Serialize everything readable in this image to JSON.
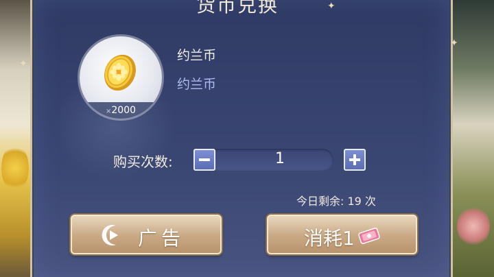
{
  "dialog": {
    "title": "货币兑换"
  },
  "item": {
    "name": "约兰币",
    "description": "约兰币",
    "quantity_prefix": "×",
    "quantity": "2000",
    "icon": "gold-coin-icon"
  },
  "purchase": {
    "count_label": "购买次数:",
    "count_value": "1",
    "remaining_text": "今日剩余: 19 次"
  },
  "buttons": {
    "ad_label": "广告",
    "consume_label": "消耗1"
  },
  "colors": {
    "panel": "#36426d",
    "accent_gold": "#d4c29a",
    "button_gradient_top": "#e7d7bd",
    "stepper_button": "#6b7cc4"
  }
}
